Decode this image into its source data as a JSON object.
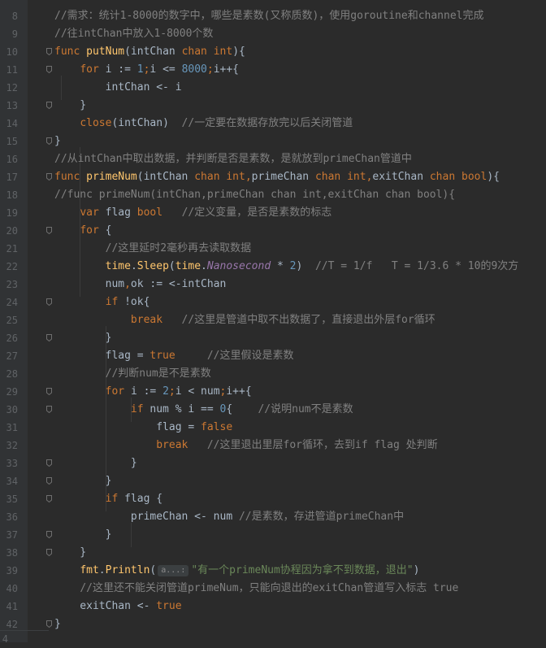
{
  "editor": {
    "lines": [
      {
        "n": "8",
        "tokens": [
          {
            "c": "cm",
            "t": "//需求：统计1-8000的数字中，哪些是素数(又称质数)，使用goroutine和channel完成"
          }
        ]
      },
      {
        "n": "9",
        "tokens": [
          {
            "c": "cm",
            "t": "//往intChan中放入1-8000个数"
          }
        ]
      },
      {
        "n": "10",
        "tokens": [
          {
            "c": "kw",
            "t": "func "
          },
          {
            "c": "fn",
            "t": "putNum"
          },
          {
            "c": "pl",
            "t": "(intChan "
          },
          {
            "c": "kw",
            "t": "chan int"
          },
          {
            "c": "pl",
            "t": "){"
          }
        ]
      },
      {
        "n": "11",
        "tokens": [
          {
            "c": "pl",
            "t": "    "
          },
          {
            "c": "kw",
            "t": "for "
          },
          {
            "c": "pl",
            "t": "i := "
          },
          {
            "c": "num",
            "t": "1"
          },
          {
            "c": "kw",
            "t": ";"
          },
          {
            "c": "pl",
            "t": "i <= "
          },
          {
            "c": "num",
            "t": "8000"
          },
          {
            "c": "kw",
            "t": ";"
          },
          {
            "c": "pl",
            "t": "i++{"
          }
        ]
      },
      {
        "n": "12",
        "tokens": [
          {
            "c": "pl",
            "t": "        intChan <- i"
          }
        ]
      },
      {
        "n": "13",
        "tokens": [
          {
            "c": "pl",
            "t": "    }"
          }
        ]
      },
      {
        "n": "14",
        "tokens": [
          {
            "c": "pl",
            "t": "    "
          },
          {
            "c": "kw",
            "t": "close"
          },
          {
            "c": "pl",
            "t": "(intChan)  "
          },
          {
            "c": "cm",
            "t": "//一定要在数据存放完以后关闭管道"
          }
        ]
      },
      {
        "n": "15",
        "tokens": [
          {
            "c": "pl",
            "t": "}"
          }
        ]
      },
      {
        "n": "16",
        "tokens": [
          {
            "c": "cm",
            "t": "//从intChan中取出数据，并判断是否是素数，是就放到primeChan管道中"
          }
        ]
      },
      {
        "n": "17",
        "tokens": [
          {
            "c": "kw",
            "t": "func "
          },
          {
            "c": "fn",
            "t": "primeNum"
          },
          {
            "c": "pl",
            "t": "(intChan "
          },
          {
            "c": "kw",
            "t": "chan int"
          },
          {
            "c": "kw",
            "t": ","
          },
          {
            "c": "pl",
            "t": "primeChan "
          },
          {
            "c": "kw",
            "t": "chan int"
          },
          {
            "c": "kw",
            "t": ","
          },
          {
            "c": "pl",
            "t": "exitChan "
          },
          {
            "c": "kw",
            "t": "chan bool"
          },
          {
            "c": "pl",
            "t": "){"
          }
        ]
      },
      {
        "n": "18",
        "tokens": [
          {
            "c": "cm",
            "t": "//func primeNum(intChan,primeChan chan int,exitChan chan bool){"
          }
        ]
      },
      {
        "n": "19",
        "tokens": [
          {
            "c": "pl",
            "t": "    "
          },
          {
            "c": "kw",
            "t": "var "
          },
          {
            "c": "pl",
            "t": "flag "
          },
          {
            "c": "kw",
            "t": "bool"
          },
          {
            "c": "pl",
            "t": "   "
          },
          {
            "c": "cm",
            "t": "//定义变量，是否是素数的标志"
          }
        ]
      },
      {
        "n": "20",
        "tokens": [
          {
            "c": "pl",
            "t": "    "
          },
          {
            "c": "kw",
            "t": "for "
          },
          {
            "c": "pl",
            "t": "{"
          }
        ]
      },
      {
        "n": "21",
        "tokens": [
          {
            "c": "pl",
            "t": "        "
          },
          {
            "c": "cm",
            "t": "//这里延时2毫秒再去读取数据"
          }
        ]
      },
      {
        "n": "22",
        "tokens": [
          {
            "c": "pl",
            "t": "        "
          },
          {
            "c": "fn",
            "t": "time"
          },
          {
            "c": "pl",
            "t": "."
          },
          {
            "c": "fn",
            "t": "Sleep"
          },
          {
            "c": "pl",
            "t": "("
          },
          {
            "c": "fn",
            "t": "time"
          },
          {
            "c": "pl",
            "t": "."
          },
          {
            "c": "it",
            "t": "Nanosecond"
          },
          {
            "c": "pl",
            "t": " * "
          },
          {
            "c": "num",
            "t": "2"
          },
          {
            "c": "pl",
            "t": ")  "
          },
          {
            "c": "cm",
            "t": "//T = 1/f   T = 1/3.6 * 10的9次方"
          }
        ]
      },
      {
        "n": "23",
        "tokens": [
          {
            "c": "pl",
            "t": "        num"
          },
          {
            "c": "kw",
            "t": ","
          },
          {
            "c": "pl",
            "t": "ok := <-intChan"
          }
        ]
      },
      {
        "n": "24",
        "tokens": [
          {
            "c": "pl",
            "t": "        "
          },
          {
            "c": "kw",
            "t": "if "
          },
          {
            "c": "pl",
            "t": "!ok{"
          }
        ]
      },
      {
        "n": "25",
        "tokens": [
          {
            "c": "pl",
            "t": "            "
          },
          {
            "c": "kw",
            "t": "break"
          },
          {
            "c": "pl",
            "t": "   "
          },
          {
            "c": "cm",
            "t": "//这里是管道中取不出数据了，直接退出外层for循环"
          }
        ]
      },
      {
        "n": "26",
        "tokens": [
          {
            "c": "pl",
            "t": "        }"
          }
        ]
      },
      {
        "n": "27",
        "tokens": [
          {
            "c": "pl",
            "t": "        flag = "
          },
          {
            "c": "kw",
            "t": "true"
          },
          {
            "c": "pl",
            "t": "     "
          },
          {
            "c": "cm",
            "t": "//这里假设是素数"
          }
        ]
      },
      {
        "n": "28",
        "tokens": [
          {
            "c": "pl",
            "t": "        "
          },
          {
            "c": "cm",
            "t": "//判断num是不是素数"
          }
        ]
      },
      {
        "n": "29",
        "tokens": [
          {
            "c": "pl",
            "t": "        "
          },
          {
            "c": "kw",
            "t": "for "
          },
          {
            "c": "pl",
            "t": "i := "
          },
          {
            "c": "num",
            "t": "2"
          },
          {
            "c": "kw",
            "t": ";"
          },
          {
            "c": "pl",
            "t": "i < num"
          },
          {
            "c": "kw",
            "t": ";"
          },
          {
            "c": "pl",
            "t": "i++{"
          }
        ]
      },
      {
        "n": "30",
        "tokens": [
          {
            "c": "pl",
            "t": "            "
          },
          {
            "c": "kw",
            "t": "if "
          },
          {
            "c": "pl",
            "t": "num % i == "
          },
          {
            "c": "num",
            "t": "0"
          },
          {
            "c": "pl",
            "t": "{    "
          },
          {
            "c": "cm",
            "t": "//说明num不是素数"
          }
        ]
      },
      {
        "n": "31",
        "tokens": [
          {
            "c": "pl",
            "t": "                flag = "
          },
          {
            "c": "kw",
            "t": "false"
          }
        ]
      },
      {
        "n": "32",
        "tokens": [
          {
            "c": "pl",
            "t": "                "
          },
          {
            "c": "kw",
            "t": "break"
          },
          {
            "c": "pl",
            "t": "   "
          },
          {
            "c": "cm",
            "t": "//这里退出里层for循环，去到if flag 处判断"
          }
        ]
      },
      {
        "n": "33",
        "tokens": [
          {
            "c": "pl",
            "t": "            }"
          }
        ]
      },
      {
        "n": "34",
        "tokens": [
          {
            "c": "pl",
            "t": "        }"
          }
        ]
      },
      {
        "n": "35",
        "tokens": [
          {
            "c": "pl",
            "t": "        "
          },
          {
            "c": "kw",
            "t": "if "
          },
          {
            "c": "pl",
            "t": "flag {"
          }
        ]
      },
      {
        "n": "36",
        "tokens": [
          {
            "c": "pl",
            "t": "            primeChan <- num "
          },
          {
            "c": "cm",
            "t": "//是素数，存进管道primeChan中"
          }
        ]
      },
      {
        "n": "37",
        "tokens": [
          {
            "c": "pl",
            "t": "        }"
          }
        ]
      },
      {
        "n": "38",
        "tokens": [
          {
            "c": "pl",
            "t": "    }"
          }
        ]
      },
      {
        "n": "39",
        "tokens": [
          {
            "c": "pl",
            "t": "    "
          },
          {
            "c": "fn",
            "t": "fmt"
          },
          {
            "c": "pl",
            "t": "."
          },
          {
            "c": "fn",
            "t": "Println"
          },
          {
            "c": "pl",
            "t": "("
          },
          {
            "c": "hint",
            "t": "a...:"
          },
          {
            "c": "str",
            "t": "\"有一个primeNum协程因为拿不到数据，退出\""
          },
          {
            "c": "pl",
            "t": ")"
          }
        ]
      },
      {
        "n": "40",
        "tokens": [
          {
            "c": "pl",
            "t": "    "
          },
          {
            "c": "cm",
            "t": "//这里还不能关闭管道primeNum，只能向退出的exitChan管道写入标志 true"
          }
        ]
      },
      {
        "n": "41",
        "tokens": [
          {
            "c": "pl",
            "t": "    exitChan <- "
          },
          {
            "c": "kw",
            "t": "true"
          }
        ]
      },
      {
        "n": "42",
        "tokens": [
          {
            "c": "pl",
            "t": "}"
          }
        ]
      }
    ],
    "fold_markers": [
      "10",
      "11",
      "13",
      "15",
      "17",
      "20",
      "24",
      "26",
      "29",
      "30",
      "33",
      "34",
      "35",
      "37",
      "38",
      "42"
    ],
    "gutter_fragments": [
      {
        "n": "43",
        "t": "4"
      }
    ]
  }
}
